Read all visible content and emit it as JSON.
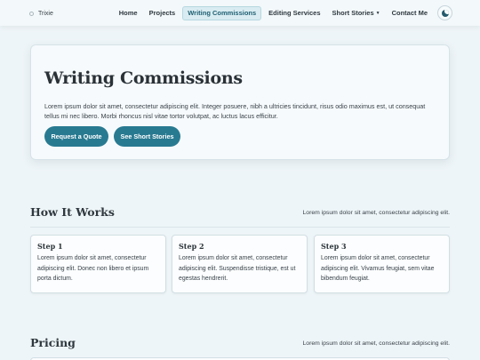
{
  "brand": {
    "name": "Trixie"
  },
  "nav": {
    "home": "Home",
    "projects": "Projects",
    "writing_commissions": "Writing Commissions",
    "editing_services": "Editing Services",
    "short_stories": "Short Stories",
    "contact": "Contact Me",
    "theme_toggle_icon": "moon-icon"
  },
  "hero": {
    "title": "Writing Commissions",
    "text": "Lorem ipsum dolor sit amet, consectetur adipiscing elit. Integer posuere, nibh a ultricies tincidunt, risus odio maximus est, ut consequat tellus mi nec libero. Morbi rhoncus nisl vitae tortor volutpat, ac luctus lacus efficitur.",
    "btn_quote": "Request a Quote",
    "btn_stories": "See Short Stories"
  },
  "how_it_works": {
    "title": "How It Works",
    "subtitle": "Lorem ipsum dolor sit amet, consectetur adipiscing elit.",
    "steps": [
      {
        "title": "Step 1",
        "text": "Lorem ipsum dolor sit amet, consectetur adipiscing elit. Donec non libero et ipsum porta dictum."
      },
      {
        "title": "Step 2",
        "text": "Lorem ipsum dolor sit amet, consectetur adipiscing elit. Suspendisse tristique, est ut egestas hendrerit."
      },
      {
        "title": "Step 3",
        "text": "Lorem ipsum dolor sit amet, consectetur adipiscing elit. Vivamus feugiat, sem vitae bibendum feugiat."
      }
    ]
  },
  "pricing": {
    "title": "Pricing",
    "subtitle": "Lorem ipsum dolor sit amet, consectetur adipiscing elit."
  }
}
